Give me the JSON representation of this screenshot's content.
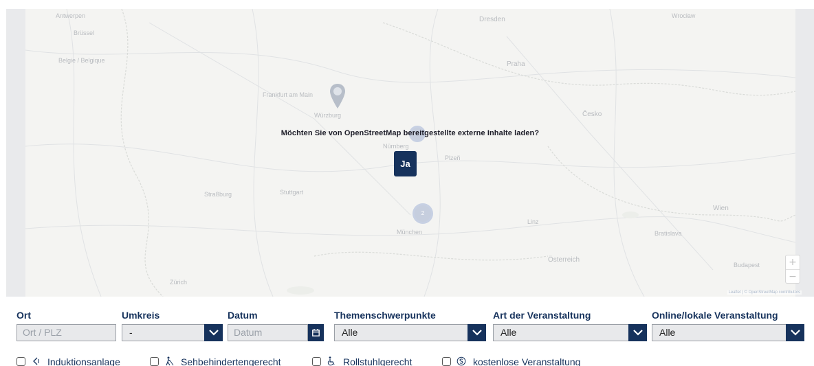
{
  "map": {
    "consent_text": "Möchten Sie von OpenStreetMap bereitgestellte externe Inhalte laden?",
    "consent_button": "Ja",
    "zoom_in": "+",
    "zoom_out": "−",
    "attribution": "Leaflet | © OpenStreetMap contributors",
    "cluster_count": "2",
    "place_labels": [
      "Antwerpen",
      "Brüssel",
      "Belgie / Belgique",
      "Frankfurt am Main",
      "Würzburg",
      "Nürnberg",
      "Straßburg",
      "Stuttgart",
      "München",
      "Dresden",
      "Praha",
      "Plzeň",
      "Linz",
      "Wien",
      "Bratislava",
      "Budapest",
      "Österreich",
      "Česko",
      "Zürich",
      "Wrocław"
    ]
  },
  "filters": {
    "ort": {
      "label": "Ort",
      "placeholder": "Ort / PLZ"
    },
    "umkreis": {
      "label": "Umkreis",
      "value": "-"
    },
    "datum": {
      "label": "Datum",
      "placeholder": "Datum"
    },
    "themen": {
      "label": "Themenschwerpunkte",
      "value": "Alle"
    },
    "art": {
      "label": "Art der Veranstaltung",
      "value": "Alle"
    },
    "online": {
      "label": "Online/lokale Veranstaltung",
      "value": "Alle"
    }
  },
  "checkboxes": [
    {
      "label": "Induktionsanlage",
      "icon": "hearing-loop-icon"
    },
    {
      "label": "Sehbehindertengerecht",
      "icon": "visually-impaired-icon"
    },
    {
      "label": "Rollstuhlgerecht",
      "icon": "wheelchair-icon"
    },
    {
      "label": "kostenlose Veranstaltung",
      "icon": "free-icon"
    }
  ],
  "colors": {
    "primary": "#16325c",
    "field_bg": "#e8e9eb",
    "map_bg": "#f4f4f2"
  }
}
